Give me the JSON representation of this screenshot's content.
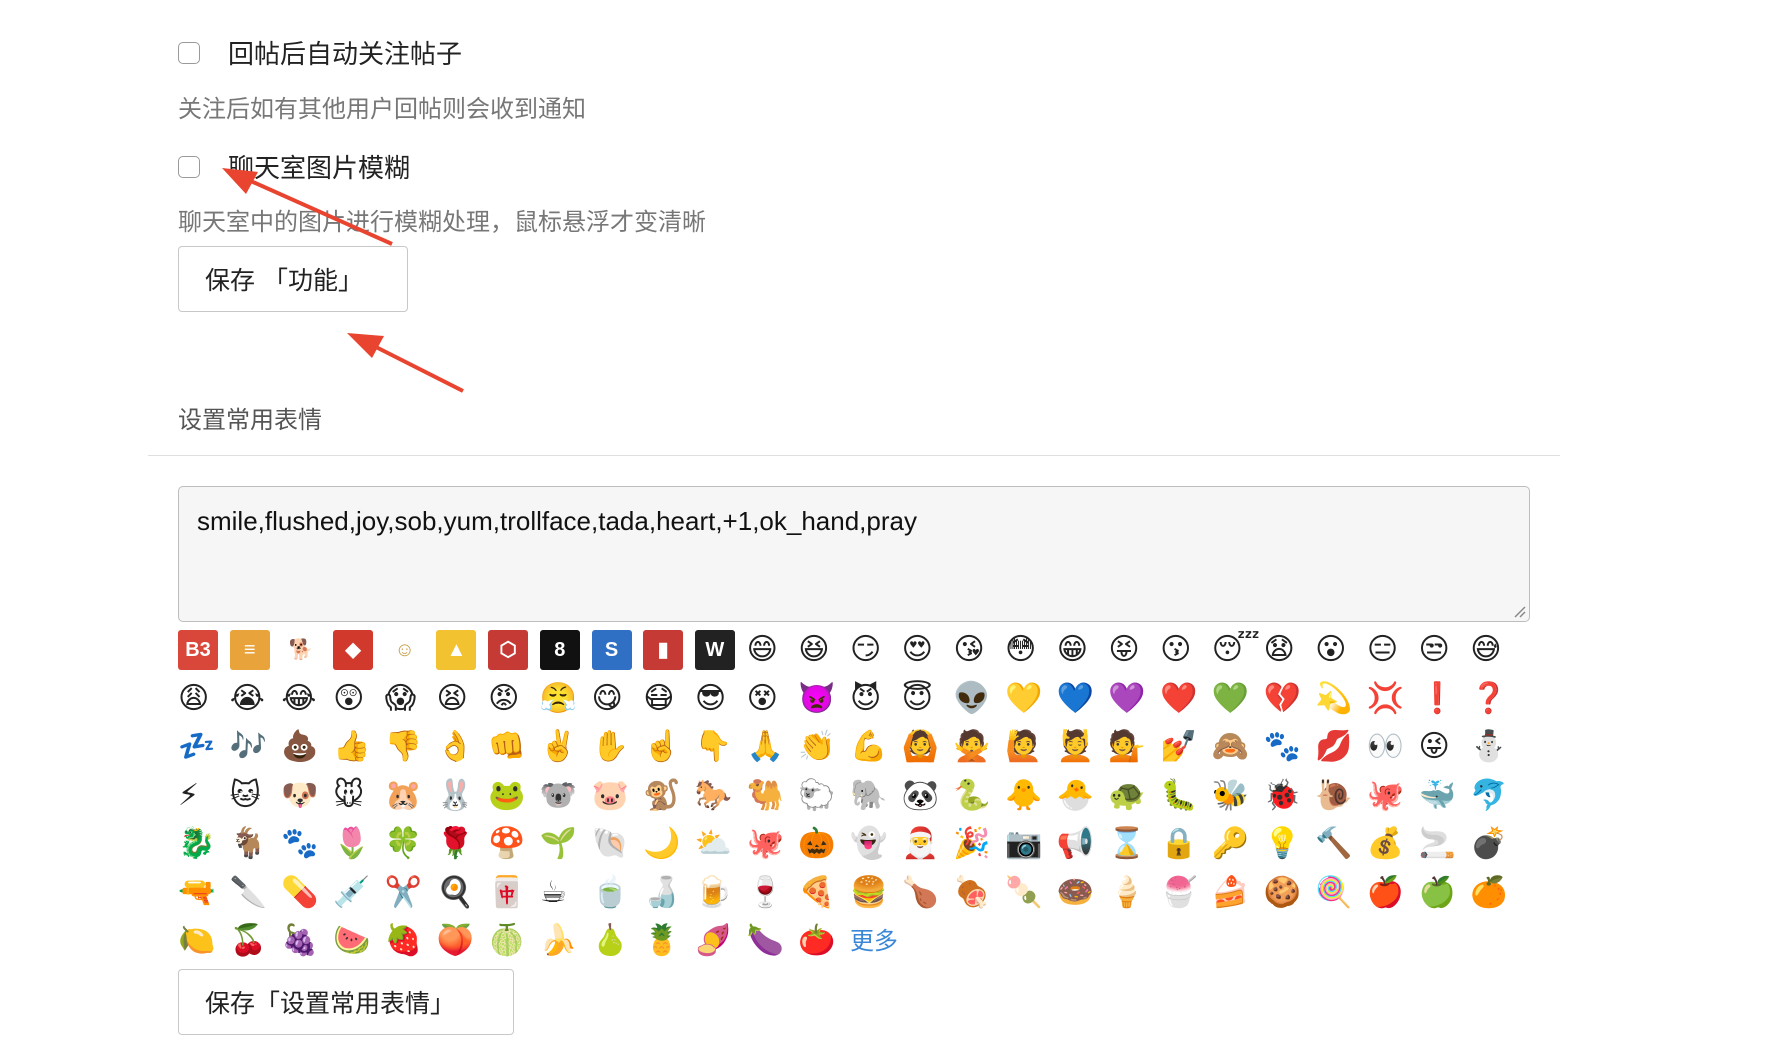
{
  "auto_follow": {
    "label": "回帖后自动关注帖子",
    "hint": "关注后如有其他用户回帖则会收到通知",
    "checked": false
  },
  "chat_blur": {
    "label": "聊天室图片模糊",
    "hint": "聊天室中的图片进行模糊处理，鼠标悬浮才变清晰",
    "checked": false
  },
  "save_function_label": "保存 「功能」",
  "emoji_section": {
    "title": "设置常用表情",
    "textarea_value": "smile,flushed,joy,sob,yum,trollface,tada,heart,+1,ok_hand,pray",
    "more_label": "更多",
    "save_label": "保存「设置常用表情」",
    "logo_tiles": [
      {
        "text": "B3",
        "color": "#d8473a"
      },
      {
        "text": "≡",
        "color": "#e8a33b"
      },
      {
        "text": "🐕",
        "color": "#ffffff"
      },
      {
        "text": "◆",
        "color": "#d0392b"
      },
      {
        "text": "☺",
        "color": "#ffffff"
      },
      {
        "text": "▲",
        "color": "#f2c230"
      },
      {
        "text": "⬡",
        "color": "#c53a34"
      },
      {
        "text": "8",
        "color": "#111111"
      },
      {
        "text": "S",
        "color": "#2f6fc4"
      },
      {
        "text": "▮",
        "color": "#c53a34"
      },
      {
        "text": "W",
        "color": "#222222"
      }
    ],
    "emojis": [
      "😄",
      "😆",
      "😏",
      "😍",
      "😘",
      "😳",
      "😁",
      "😝",
      "😗",
      "😴",
      "😧",
      "😮",
      "😑",
      "😒",
      "😅",
      "😩",
      "😭",
      "😂",
      "😲",
      "😱",
      "😫",
      "😡",
      "😤",
      "😋",
      "😷",
      "😎",
      "😵",
      "👿",
      "😈",
      "😇",
      "👽",
      "💛",
      "💙",
      "💜",
      "❤️",
      "💚",
      "💔",
      "💫",
      "💢",
      "❗",
      "❓",
      "💤",
      "🎶",
      "💩",
      "👍",
      "👎",
      "👌",
      "👊",
      "✌️",
      "✋",
      "☝️",
      "👇",
      "🙏",
      "👏",
      "💪",
      "🙆",
      "🙅",
      "🙋",
      "💆",
      "💁",
      "💅",
      "🙈",
      "🐾",
      "💋",
      "👀",
      "😜",
      "⛄",
      "⚡",
      "🐱",
      "🐶",
      "🐭",
      "🐹",
      "🐰",
      "🐸",
      "🐨",
      "🐷",
      "🐒",
      "🐎",
      "🐫",
      "🐑",
      "🐘",
      "🐼",
      "🐍",
      "🐥",
      "🐣",
      "🐢",
      "🐛",
      "🐝",
      "🐞",
      "🐌",
      "🐙",
      "🐳",
      "🐬",
      "🐉",
      "🐐",
      "🐾",
      "🌷",
      "🍀",
      "🌹",
      "🍄",
      "🌱",
      "🐚",
      "🌙",
      "⛅",
      "🐙",
      "🎃",
      "👻",
      "🎅",
      "🎉",
      "📷",
      "📢",
      "⌛",
      "🔒",
      "🔑",
      "💡",
      "🔨",
      "💰",
      "🚬",
      "💣",
      "🔫",
      "🔪",
      "💊",
      "💉",
      "✂️",
      "🍳",
      "🀄",
      "☕",
      "🍵",
      "🍶",
      "🍺",
      "🍷",
      "🍕",
      "🍔",
      "🍗",
      "🍖",
      "🍡",
      "🍩",
      "🍦",
      "🍧",
      "🍰",
      "🍪",
      "🍭",
      "🍎",
      "🍏",
      "🍊",
      "🍋",
      "🍒",
      "🍇",
      "🍉",
      "🍓",
      "🍑",
      "🍈",
      "🍌",
      "🍐",
      "🍍",
      "🍠",
      "🍆",
      "🍅"
    ]
  }
}
